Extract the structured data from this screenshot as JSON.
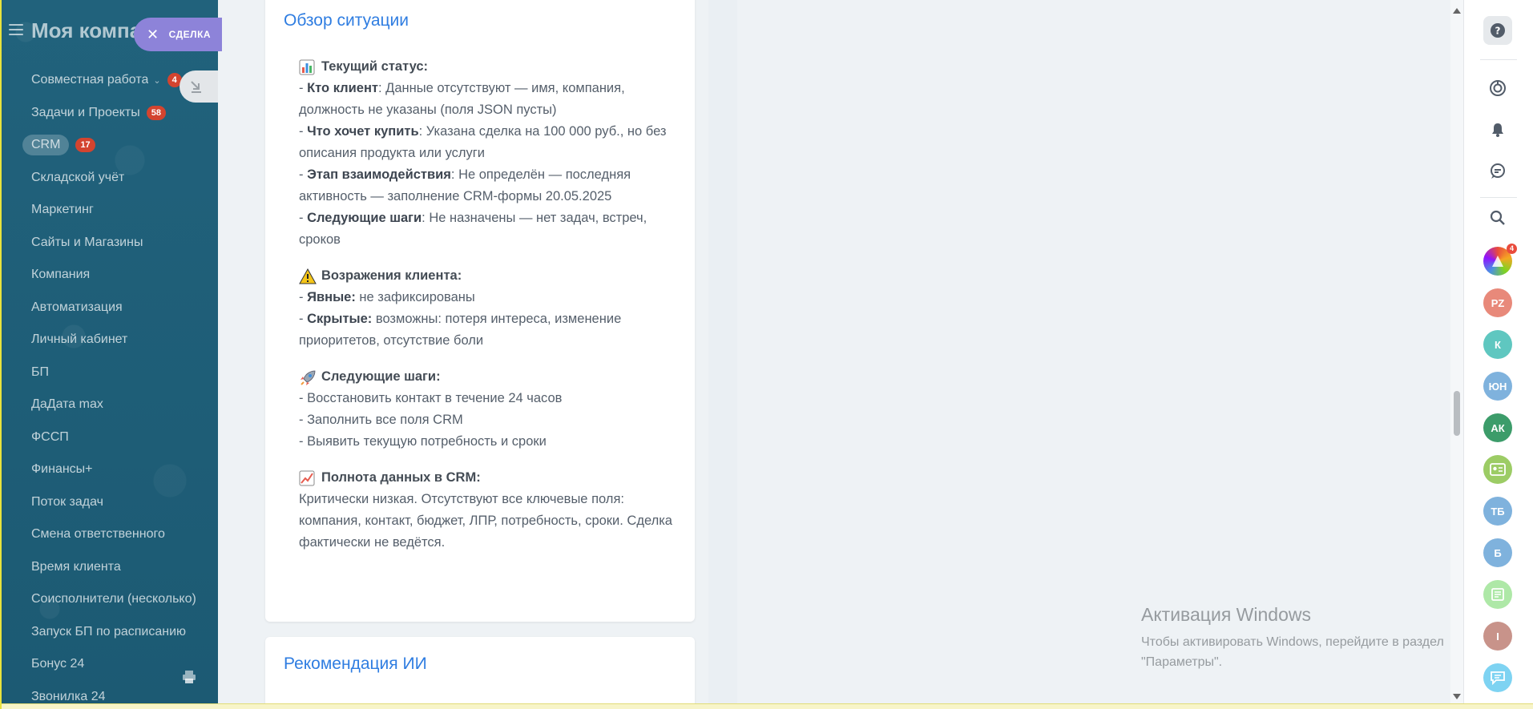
{
  "sidebar": {
    "company_name": "Моя компания",
    "deal_chip_label": "СДЕЛКА",
    "items": [
      {
        "label": "Совместная работа",
        "badge": "4",
        "has_chevron": true
      },
      {
        "label": "Задачи и Проекты",
        "badge": "58"
      },
      {
        "label": "CRM",
        "badge": "17",
        "active": true
      },
      {
        "label": "Складской учёт"
      },
      {
        "label": "Маркетинг"
      },
      {
        "label": "Сайты и Магазины"
      },
      {
        "label": "Компания"
      },
      {
        "label": "Автоматизация"
      },
      {
        "label": "Личный кабинет"
      },
      {
        "label": "БП"
      },
      {
        "label": "ДаДата max"
      },
      {
        "label": "ФССП"
      },
      {
        "label": "Финансы+"
      },
      {
        "label": "Поток задач"
      },
      {
        "label": "Смена ответственного"
      },
      {
        "label": "Время клиента"
      },
      {
        "label": "Соисполнители (несколько)"
      },
      {
        "label": "Запуск БП по расписанию"
      },
      {
        "label": "Бонус 24"
      },
      {
        "label": "Звонилка 24"
      }
    ]
  },
  "overview": {
    "title": "Обзор ситуации",
    "sections": [
      {
        "icon": "bar-chart-emoji",
        "heading": "Текущий статус:",
        "lines": [
          {
            "bold": "Кто клиент",
            "text": ": Данные отсутствуют — имя, компания, должность не указаны (поля JSON пусты)"
          },
          {
            "bold": "Что хочет купить",
            "text": ": Указана сделка на 100 000 руб., но без описания продукта или услуги"
          },
          {
            "bold": "Этап взаимодействия",
            "text": ": Не определён — последняя активность — заполнение CRM-формы 20.05.2025"
          },
          {
            "bold": "Следующие шаги",
            "text": ": Не назначены — нет задач, встреч, сроков"
          }
        ]
      },
      {
        "icon": "warning-emoji",
        "heading": "Возражения клиента:",
        "lines": [
          {
            "bold": "Явные:",
            "text": " не зафиксированы"
          },
          {
            "bold": "Скрытые:",
            "text": " возможны: потеря интереса, изменение приоритетов, отсутствие боли"
          }
        ]
      },
      {
        "icon": "rocket-emoji",
        "heading": "Следующие шаги:",
        "lines": [
          {
            "bold": "",
            "text": "Восстановить контакт в течение 24 часов"
          },
          {
            "bold": "",
            "text": "Заполнить все поля CRM"
          },
          {
            "bold": "",
            "text": "Выявить текущую потребность и сроки"
          }
        ]
      },
      {
        "icon": "trend-chart-emoji",
        "heading": "Полнота данных в CRM:",
        "paragraph": "Критически низкая. Отсутствуют все ключевые поля: компания, контакт, бюджет, ЛПР, потребность, сроки. Сделка фактически не ведётся."
      }
    ]
  },
  "recommendation": {
    "title": "Рекомендация ИИ"
  },
  "windows_activation": {
    "title": "Активация Windows",
    "line1": "Чтобы активировать Windows, перейдите в раздел",
    "line2": "\"Параметры\"."
  },
  "rail": {
    "avatars": [
      {
        "initials": "",
        "color": "#e04a3f",
        "count": "4",
        "kind": "colorful-logo"
      },
      {
        "initials": "PZ",
        "color": "#e8897a"
      },
      {
        "initials": "К",
        "color": "#5fc7c0"
      },
      {
        "initials": "ЮН",
        "color": "#7fb2dd"
      },
      {
        "initials": "АК",
        "color": "#3c9c6a"
      },
      {
        "initials": "",
        "color": "#9ccc65",
        "kind": "contact-card"
      },
      {
        "initials": "ТБ",
        "color": "#7fb2dd"
      },
      {
        "initials": "Б",
        "color": "#7fb2dd"
      },
      {
        "initials": "",
        "color": "#aee8a7",
        "kind": "doc"
      },
      {
        "initials": "I",
        "color": "#c8938a"
      },
      {
        "initials": "",
        "color": "#7ed3f2",
        "kind": "chat"
      }
    ]
  },
  "colors": {
    "sidebar_bg": "#1e5e78",
    "accent_blue": "#2f7de1",
    "deal_chip": "#8d83d9",
    "badge_red": "#d3442f"
  }
}
